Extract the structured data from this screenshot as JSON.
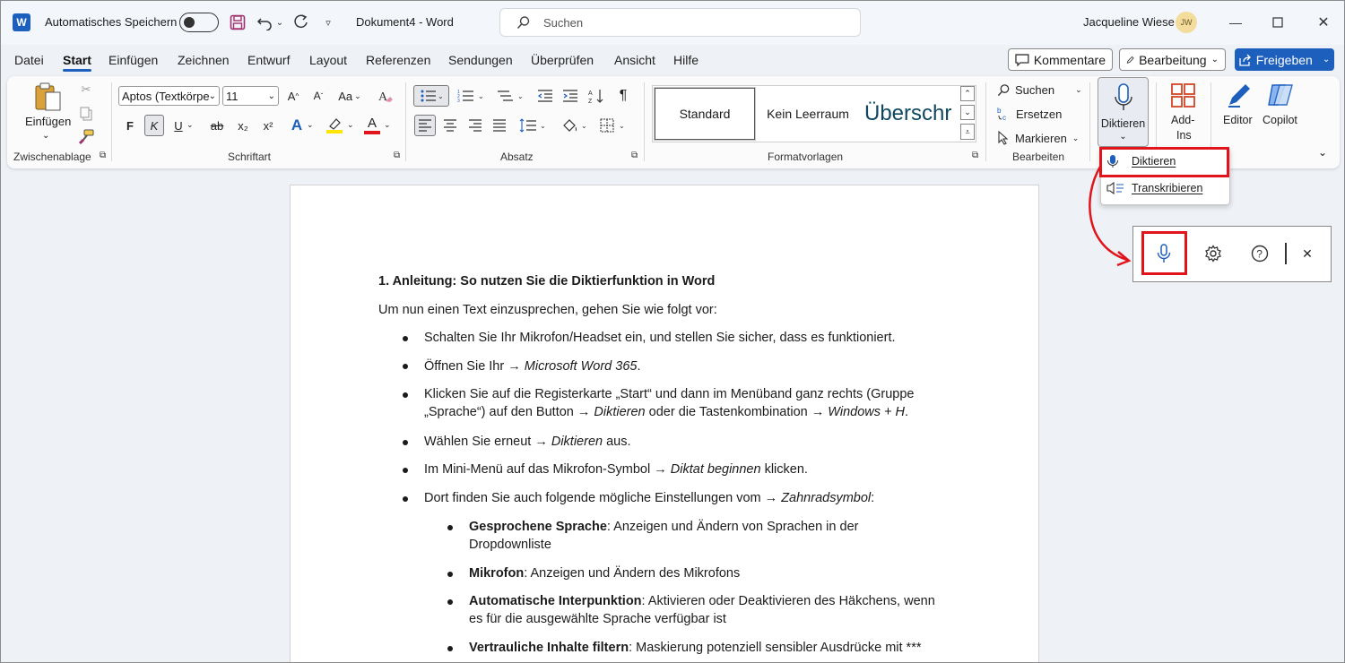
{
  "titlebar": {
    "app_logo": "W",
    "autosave_label": "Automatisches Speichern",
    "document_title": "Dokument4  -  Word",
    "search_placeholder": "Suchen",
    "user_name": "Jacqueline Wiese",
    "user_initials": "JW"
  },
  "tabs": [
    "Datei",
    "Start",
    "Einfügen",
    "Zeichnen",
    "Entwurf",
    "Layout",
    "Referenzen",
    "Sendungen",
    "Überprüfen",
    "Ansicht",
    "Hilfe"
  ],
  "actions": {
    "comments": "Kommentare",
    "editing": "Bearbeitung",
    "share": "Freigeben"
  },
  "ribbon": {
    "clipboard": {
      "paste": "Einfügen",
      "group": "Zwischenablage"
    },
    "font": {
      "font_name": "Aptos (Textkörpe",
      "font_size": "11",
      "bold": "F",
      "italic": "K",
      "underline": "U",
      "strike": "ab",
      "sub": "x₂",
      "sup": "x²",
      "grow": "A^",
      "shrink": "Aˇ",
      "case": "Aa",
      "group": "Schriftart"
    },
    "paragraph": {
      "group": "Absatz"
    },
    "styles": {
      "items": [
        "Standard",
        "Kein Leerraum",
        "Überschr"
      ],
      "group": "Formatvorlagen"
    },
    "editing": {
      "find": "Suchen",
      "replace": "Ersetzen",
      "select": "Markieren",
      "group": "Bearbeiten"
    },
    "dictate": "Diktieren",
    "addins_line1": "Add-",
    "addins_line2": "Ins",
    "editor": "Editor",
    "copilot": "Copilot"
  },
  "dropdown": {
    "dictate": "Diktieren",
    "transcribe": "Transkribieren"
  },
  "colors": {
    "accent": "#1c5fbd",
    "highlight_box": "#e1131b",
    "font_color": "#e1131b",
    "highlighter": "#ffe600"
  },
  "document": {
    "heading": "1. Anleitung: So nutzen Sie die Diktierfunktion in Word",
    "intro": "Um nun einen Text einzusprechen, gehen Sie wie folgt vor:",
    "b1": "Schalten Sie Ihr Mikrofon/Headset ein, und stellen Sie sicher, dass es funktioniert.",
    "b2_a": "Öffnen Sie Ihr → ",
    "b2_b": "Microsoft Word 365",
    "b2_c": ".",
    "b3_l1": "Klicken Sie auf die Registerkarte „Start“ und dann im Menüband ganz rechts (Gruppe",
    "b3_l2_a": "„Sprache“) auf den Button → ",
    "b3_l2_b": "Diktieren",
    "b3_l2_c": " oder die Tastenkombination → ",
    "b3_l2_d": "Windows + H",
    "b4_a": "Wählen Sie erneut → ",
    "b4_b": "Diktieren",
    "b4_c": " aus.",
    "b5_a": "Im Mini-Menü auf das Mikrofon-Symbol → ",
    "b5_b": "Diktat beginnen",
    "b5_c": " klicken.",
    "b6_a": "Dort finden Sie auch folgende mögliche Einstellungen vom → ",
    "b6_b": "Zahnradsymbol",
    "b6_c": ":",
    "s1_b": "Gesprochene Sprache",
    "s1_t": ": Anzeigen und Ändern von Sprachen in der",
    "s1_l2": "Dropdownliste",
    "s2_b": "Mikrofon",
    "s2_t": ": Anzeigen und Ändern des Mikrofons",
    "s3_b": "Automatische Interpunktion",
    "s3_t": ": Aktivieren oder Deaktivieren des Häkchens, wenn",
    "s3_l2": "es für die ausgewählte Sprache verfügbar ist",
    "s4_b": "Vertrauliche Inhalte filtern",
    "s4_t": ": Maskierung potenziell sensibler Ausdrücke mit ***"
  }
}
